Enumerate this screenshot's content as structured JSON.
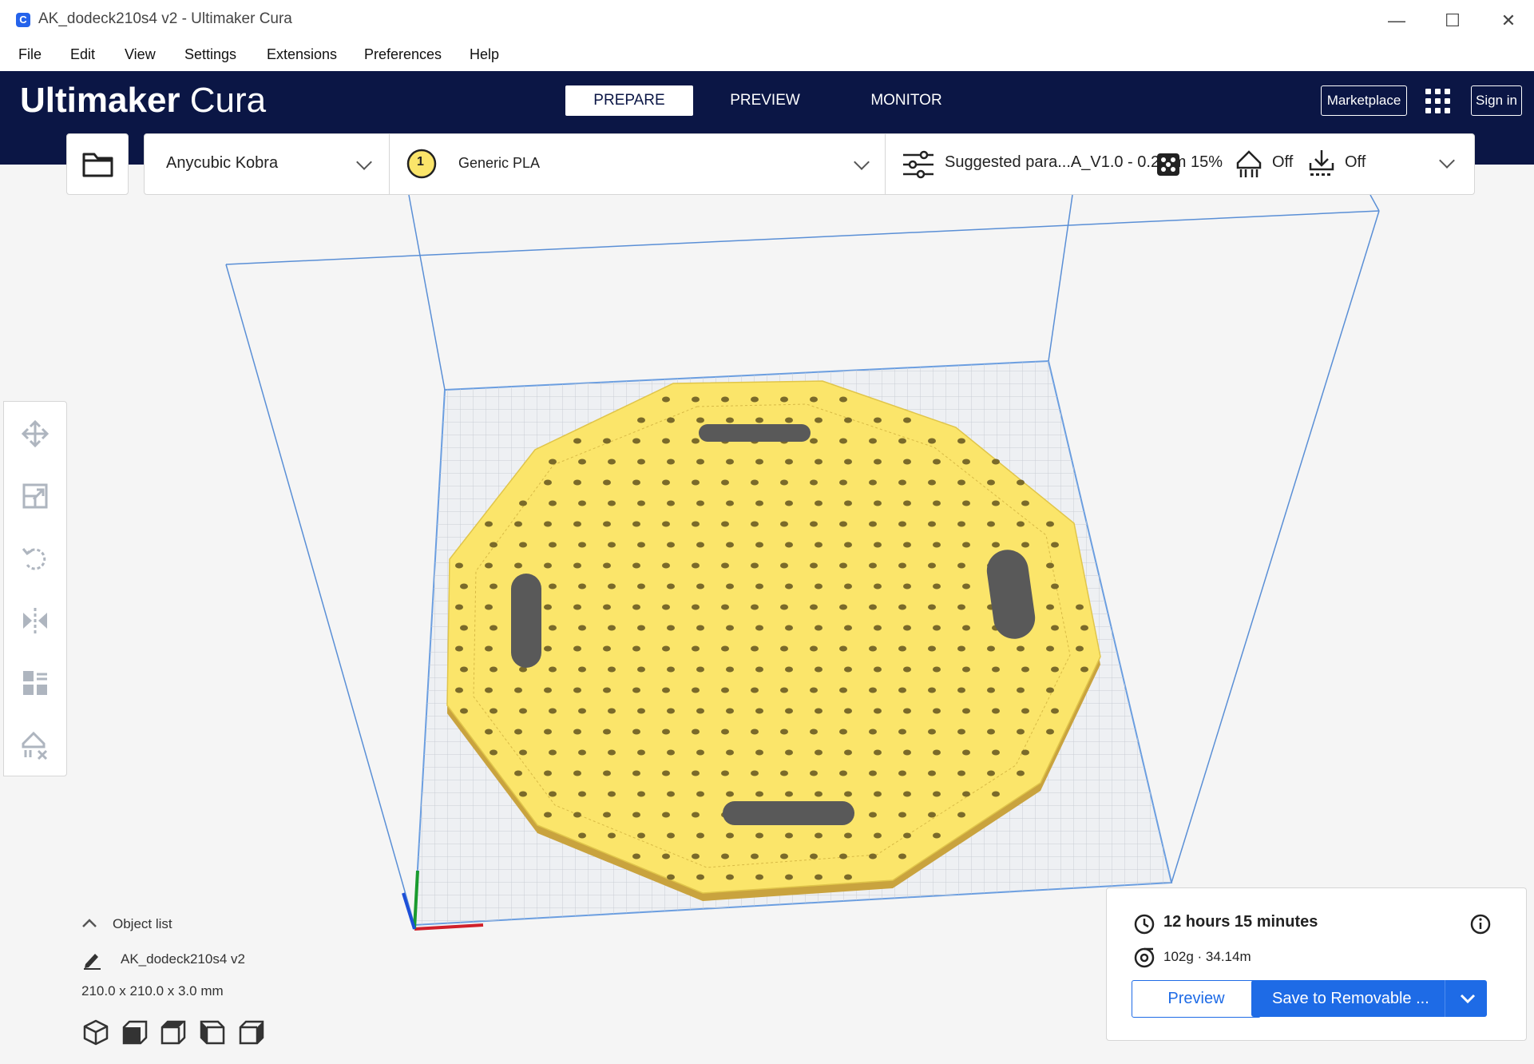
{
  "window": {
    "title": "AK_dodeck210s4 v2 - Ultimaker Cura",
    "app_icon": "C"
  },
  "window_controls": {
    "minimize": "—",
    "maximize": "☐",
    "close": "✕"
  },
  "menu": [
    "File",
    "Edit",
    "View",
    "Settings",
    "Extensions",
    "Preferences",
    "Help"
  ],
  "header": {
    "logo_bold": "Ultimaker",
    "logo_light": " Cura",
    "tabs": [
      "PREPARE",
      "PREVIEW",
      "MONITOR"
    ],
    "active_tab": "PREPARE",
    "marketplace": "Marketplace",
    "sign_in": "Sign in"
  },
  "toolbar": {
    "printer": "Anycubic Kobra",
    "extruder_number": "1",
    "material": "Generic PLA",
    "profile": "Suggested para...A_V1.0 - 0.2mm",
    "infill": "15%",
    "support": "Off",
    "adhesion": "Off"
  },
  "object_list": {
    "title": "Object list",
    "object_name": "AK_dodeck210s4 v2",
    "dimensions": "210.0 x 210.0 x 3.0 mm"
  },
  "print_info": {
    "time": "12 hours 15 minutes",
    "material": "102g · 34.14m",
    "preview_label": "Preview",
    "save_label": "Save to Removable ..."
  },
  "colors": {
    "header_bg": "#0b1645",
    "accent": "#1e6be6",
    "model_yellow": "#fbe56a",
    "build_volume": "#5a8fd6"
  }
}
